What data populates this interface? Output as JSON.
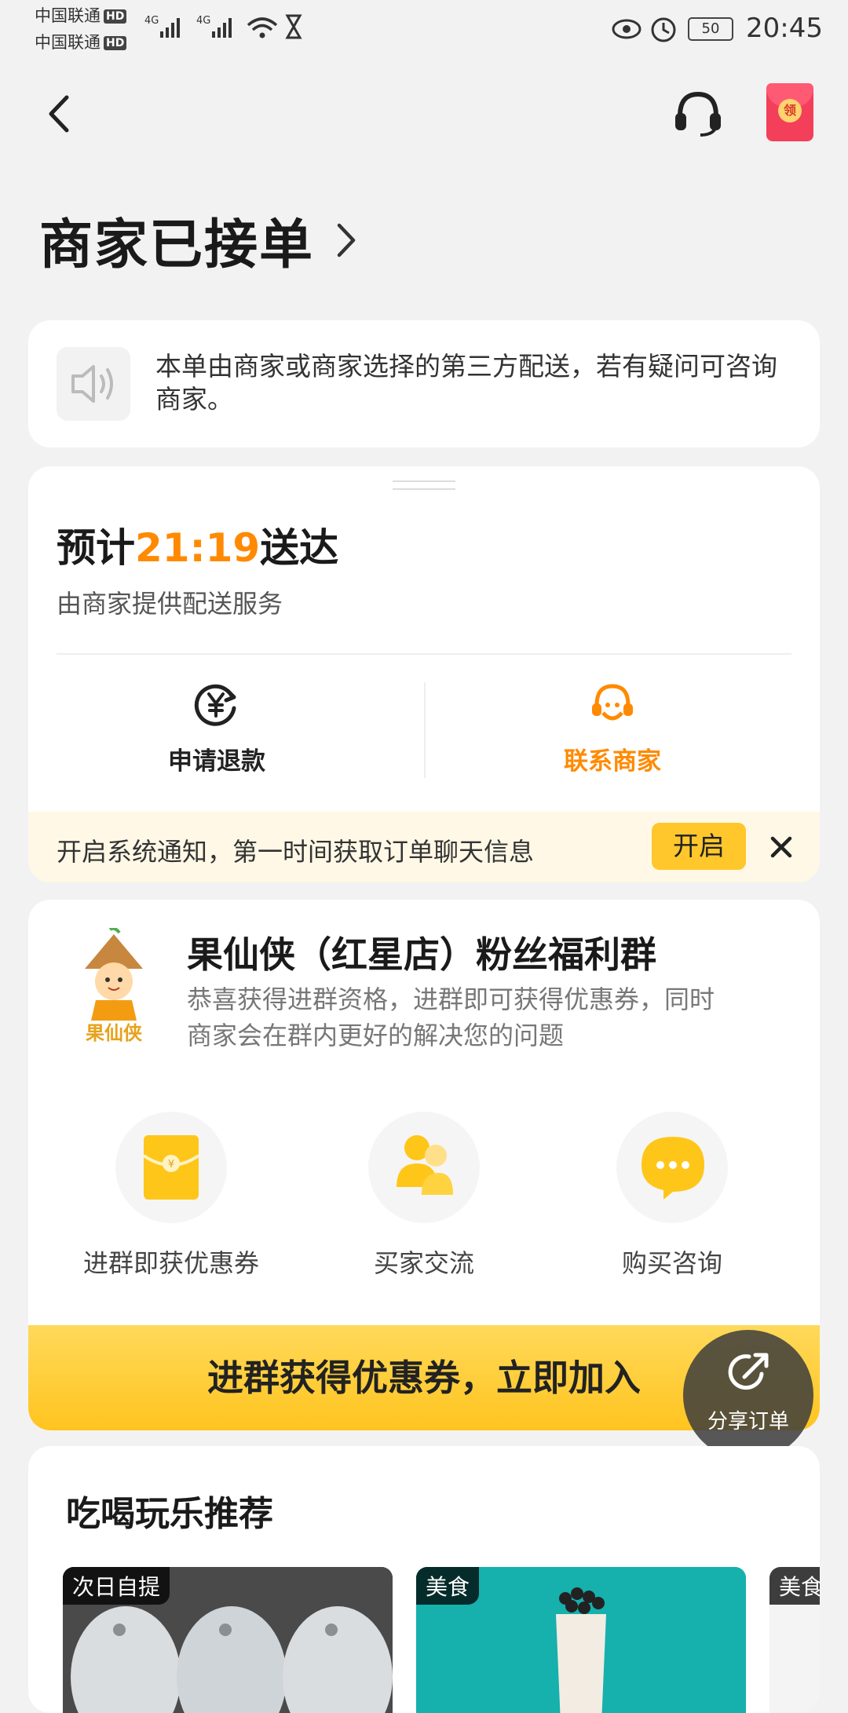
{
  "status_bar": {
    "carrier1": "中国联通",
    "carrier2": "中国联通",
    "hd": "HD",
    "net": "4G",
    "battery": "50",
    "time": "20:45"
  },
  "header": {
    "redpacket_label": "领"
  },
  "page_title": "商家已接单",
  "notice": {
    "text": "本单由商家或商家选择的第三方配送，若有疑问可咨询商家。"
  },
  "delivery": {
    "eta_prefix": "预计",
    "eta_time": "21:19",
    "eta_suffix": "送达",
    "service": "由商家提供配送服务",
    "refund_label": "申请退款",
    "contact_label": "联系商家"
  },
  "notify_banner": {
    "text": "开启系统通知，第一时间获取订单聊天信息",
    "open_label": "开启"
  },
  "group": {
    "logo_text": "果仙侠",
    "title": "果仙侠（红星店）粉丝福利群",
    "desc_line1": "恭喜获得进群资格，进群即可获得优惠券，同时",
    "desc_line2": "商家会在群内更好的解决您的问题",
    "features": [
      {
        "label": "进群即获优惠券",
        "icon": "coupon-envelope-icon"
      },
      {
        "label": "买家交流",
        "icon": "users-icon"
      },
      {
        "label": "购买咨询",
        "icon": "chat-bubble-icon"
      }
    ],
    "join_label": "进群获得优惠券，立即加入"
  },
  "share": {
    "label": "分享订单"
  },
  "recommend": {
    "title": "吃喝玩乐推荐",
    "items": [
      {
        "tag": "次日自提"
      },
      {
        "tag": "美食"
      },
      {
        "tag": "美食"
      }
    ]
  },
  "colors": {
    "accent": "#ff8a00",
    "yellow": "#ffc72c"
  }
}
